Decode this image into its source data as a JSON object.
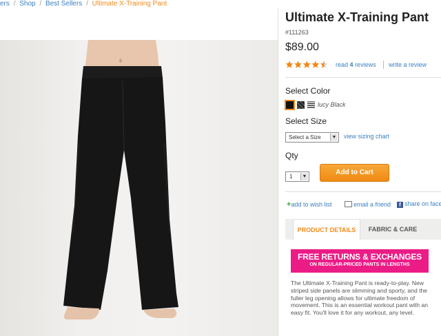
{
  "breadcrumb": {
    "first": "ers",
    "shop": "Shop",
    "best_sellers": "Best Sellers",
    "current": "Ultimate X-Training Pant",
    "separator": "/"
  },
  "product": {
    "title": "Ultimate X-Training Pant",
    "sku": "#111263",
    "price": "$89.00",
    "rating": 4.5,
    "reviews_prefix": "read",
    "reviews_count": "4",
    "reviews_suffix": "reviews",
    "write_review": "write a review"
  },
  "color": {
    "heading": "Select Color",
    "selected_name": "lucy Black",
    "swatches": [
      "black",
      "charcoal-stripe",
      "white-stripe"
    ]
  },
  "size": {
    "heading": "Select Size",
    "select_value": "Select a Size",
    "sizing_chart": "view sizing chart"
  },
  "qty": {
    "heading": "Qty",
    "value": "1"
  },
  "cart": {
    "label": "Add to Cart"
  },
  "share": {
    "wishlist": "add to wish list",
    "email": "email a friend",
    "facebook": "share on face"
  },
  "tabs": [
    {
      "label": "PRODUCT DETAILS",
      "active": true
    },
    {
      "label": "FABRIC & CARE",
      "active": false
    }
  ],
  "promo": {
    "line1": "FREE RETURNS & EXCHANGES",
    "line2": "ON REGULAR-PRICED PANTS IN LENGTHS"
  },
  "description": "The Ultimate X-Training Pant is ready-to-play. New striped side panels are slimming and sporty, and the fuller leg opening allows for ultimate freedom of movement. This is an essential workout pant with an easy fit. You'll love it for any workout, any level.",
  "colors": {
    "link": "#3a7fc0",
    "accent": "#f08a1a",
    "promo": "#ec1c86",
    "star": "#f08a1a"
  }
}
